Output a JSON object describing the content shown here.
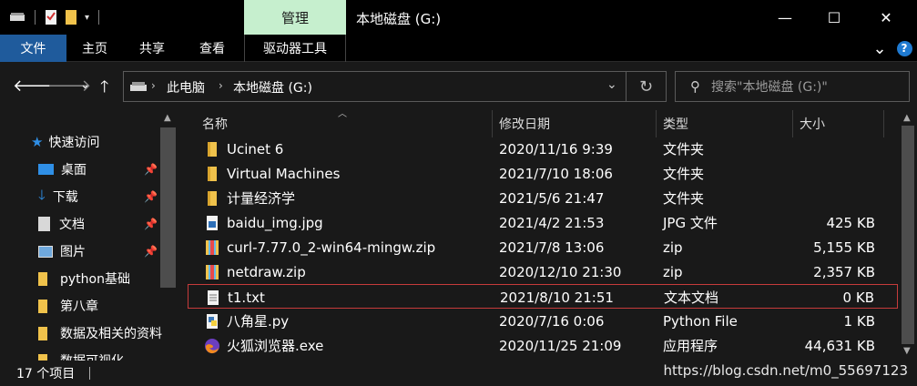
{
  "window": {
    "context_tab": "管理",
    "title": "本地磁盘 (G:)",
    "minimize": "—",
    "maximize": "☐",
    "close": "✕"
  },
  "ribbon": {
    "tabs": [
      "文件",
      "主页",
      "共享",
      "查看",
      "驱动器工具"
    ],
    "help_chevron": "⌄",
    "help": "?"
  },
  "address": {
    "crumbs": [
      "此电脑",
      "本地磁盘 (G:)"
    ],
    "search_placeholder": "搜索\"本地磁盘 (G:)\""
  },
  "sidebar": {
    "items": [
      {
        "label": "快速访问",
        "icon": "star-icon",
        "pinned": false
      },
      {
        "label": "桌面",
        "icon": "desktop-icon",
        "pinned": true
      },
      {
        "label": "下载",
        "icon": "download-icon",
        "pinned": true
      },
      {
        "label": "文档",
        "icon": "document-icon",
        "pinned": true
      },
      {
        "label": "图片",
        "icon": "picture-icon",
        "pinned": true
      },
      {
        "label": "python基础",
        "icon": "folder-icon",
        "pinned": false
      },
      {
        "label": "第八章",
        "icon": "folder-icon",
        "pinned": false
      },
      {
        "label": "数据及相关的资料",
        "icon": "folder-icon",
        "pinned": false
      },
      {
        "label": "数据可视化",
        "icon": "folder-icon",
        "pinned": false
      }
    ]
  },
  "columns": {
    "name": "名称",
    "date": "修改日期",
    "type": "类型",
    "size": "大小"
  },
  "files": [
    {
      "name": "Ucinet 6",
      "date": "2020/11/16 9:39",
      "type": "文件夹",
      "size": "",
      "icon": "folder-icon"
    },
    {
      "name": "Virtual Machines",
      "date": "2021/7/10 18:06",
      "type": "文件夹",
      "size": "",
      "icon": "folder-icon"
    },
    {
      "name": "计量经济学",
      "date": "2021/5/6 21:47",
      "type": "文件夹",
      "size": "",
      "icon": "folder-icon"
    },
    {
      "name": "baidu_img.jpg",
      "date": "2021/4/2 21:53",
      "type": "JPG 文件",
      "size": "425 KB",
      "icon": "image-file-icon"
    },
    {
      "name": "curl-7.77.0_2-win64-mingw.zip",
      "date": "2021/7/8 13:06",
      "type": "zip",
      "size": "5,155 KB",
      "icon": "zip-file-icon"
    },
    {
      "name": "netdraw.zip",
      "date": "2020/12/10 21:30",
      "type": "zip",
      "size": "2,357 KB",
      "icon": "zip-file-icon"
    },
    {
      "name": "t1.txt",
      "date": "2021/8/10 21:51",
      "type": "文本文档",
      "size": "0 KB",
      "icon": "text-file-icon",
      "selected": true
    },
    {
      "name": "八角星.py",
      "date": "2020/7/16 0:06",
      "type": "Python File",
      "size": "1 KB",
      "icon": "python-file-icon"
    },
    {
      "name": "火狐浏览器.exe",
      "date": "2020/11/25 21:09",
      "type": "应用程序",
      "size": "44,631 KB",
      "icon": "firefox-icon"
    }
  ],
  "status": {
    "count": "17 个项目",
    "watermark": "https://blog.csdn.net/m0_55697123"
  },
  "colors": {
    "file_tab": "#1f5b9c",
    "context_tab": "#c6efce",
    "selection_outline": "#c63b3b",
    "folder": "#f0c24b"
  }
}
